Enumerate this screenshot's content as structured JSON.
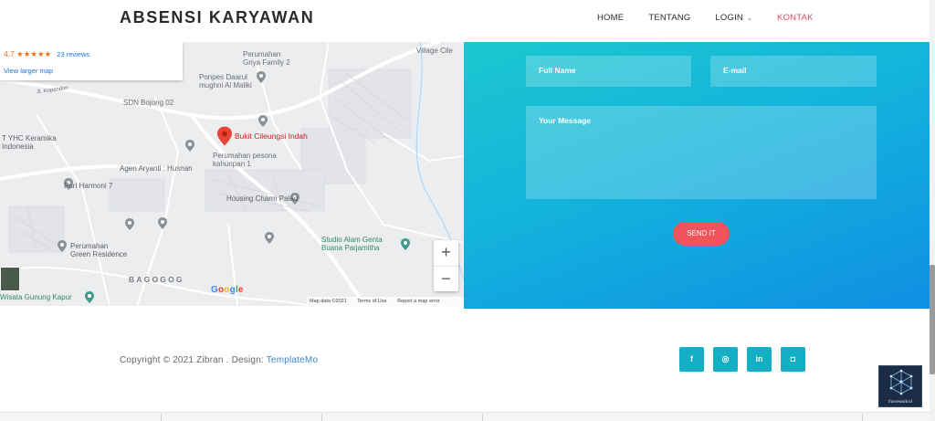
{
  "header": {
    "brand": "ABSENSI KARYAWAN",
    "nav": [
      {
        "label": "HOME"
      },
      {
        "label": "TENTANG"
      },
      {
        "label": "LOGIN",
        "has_dropdown": true
      },
      {
        "label": "KONTAK",
        "active": true
      }
    ]
  },
  "map": {
    "rating": "4.7 ★★★★★",
    "reviews": "23 reviews",
    "view_larger": "View larger map",
    "places": {
      "griya": "Perumahan\nGriya Family 2",
      "village": "Village Cile",
      "kopandan": "Jl. Kopandan",
      "ponpes": "Ponpes Daarul\nmughni Al Maliki",
      "sdn": "SDN Bojong 02",
      "bukit": "Bukit Cileungsi Indah",
      "yhc": "T YHC Keramika\nIndonesia",
      "pesona": "Perumahan pesona\nkahuripan 1",
      "agen": "Agen Aryanti : Husnan",
      "puri": "Puri Harmoni 7",
      "housing": "Housing Charm Palad",
      "studio": "Studio Alam Genta\nBuana Parjamitha",
      "green": "Perumahan\nGreen Residence",
      "bagogog": "BAGOGOG",
      "wisata": "Wisata Gunung Kapur"
    },
    "google": "Google",
    "map_data": "Map data ©2021",
    "terms": "Terms of Use",
    "report": "Report a map error"
  },
  "contact": {
    "full_name_placeholder": "Full Name",
    "email_placeholder": "E-mail",
    "message_placeholder": "Your Message",
    "send_label": "SEND IT"
  },
  "footer": {
    "copyright": "Copyright © 2021 Zibran . Design: ",
    "design_link": "TemplateMo",
    "social": [
      {
        "icon": "facebook-icon",
        "glyph": "f"
      },
      {
        "icon": "github-icon",
        "glyph": "◎"
      },
      {
        "icon": "linkedin-icon",
        "glyph": "in"
      },
      {
        "icon": "instagram-icon",
        "glyph": "◘"
      }
    ]
  },
  "watermark": "framework.id",
  "colors": {
    "accent": "#e04b63",
    "panel_gradient_start": "#1cc7cf",
    "panel_gradient_end": "#0f8fe3",
    "send_button": "#f0535b",
    "social_button": "#15afc4",
    "link": "#3a84c9"
  }
}
